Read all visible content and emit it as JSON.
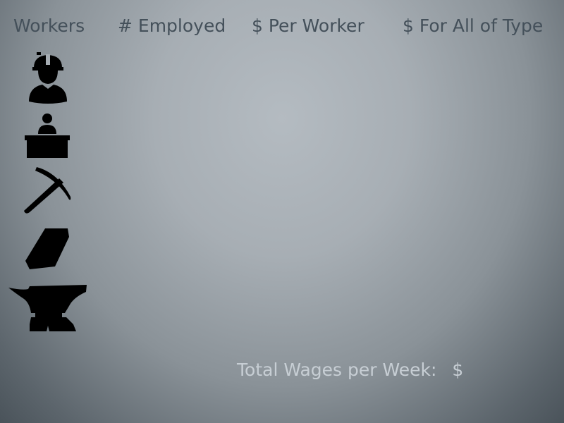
{
  "header": {
    "workers": "Workers",
    "employed": "# Employed",
    "per_worker": "$ Per Worker",
    "for_all": "$ For All of Type"
  },
  "worker_types": [
    {
      "icon": "construction-worker-icon"
    },
    {
      "icon": "desk-clerk-icon"
    },
    {
      "icon": "pickaxe-icon"
    },
    {
      "icon": "ingot-bar-icon"
    },
    {
      "icon": "anvil-icon"
    }
  ],
  "footer": {
    "total_label": "Total Wages per Week:",
    "currency": "$"
  }
}
